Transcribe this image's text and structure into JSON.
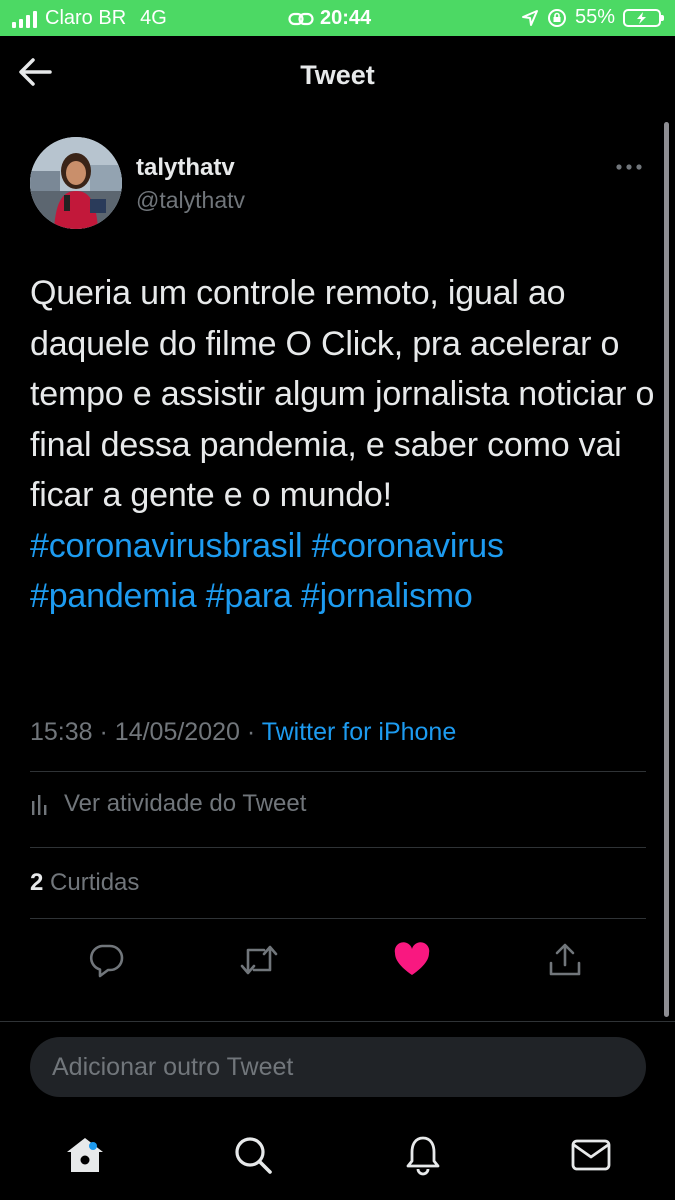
{
  "status_bar": {
    "carrier": "Claro BR",
    "network": "4G",
    "time": "20:44",
    "battery": "55%",
    "background": "#4cd964"
  },
  "header": {
    "title": "Tweet",
    "back_icon": "arrow-left-icon"
  },
  "tweet": {
    "display_name": "talythatv",
    "handle": "@talythatv",
    "text": "Queria um controle remoto, igual ao daquele do filme O Click, pra acelerar o tempo e assistir algum jornalista noticiar o final dessa pandemia, e saber como vai ficar a gente e o mundo!",
    "hashtags": [
      "#coronavirusbrasil",
      "#coronavirus",
      "#pandemia",
      "#para",
      "#jornalismo"
    ],
    "time": "15:38",
    "date": "14/05/2020",
    "separator": "·",
    "source": "Twitter for iPhone",
    "activity_label": "Ver atividade do Tweet",
    "likes_count": "2",
    "likes_label": "Curtidas",
    "liked": true
  },
  "actions": [
    "reply-icon",
    "retweet-icon",
    "heart-icon",
    "share-icon"
  ],
  "compose": {
    "placeholder": "Adicionar outro Tweet"
  },
  "tab_bar": [
    "home-icon",
    "search-icon",
    "bell-icon",
    "mail-icon"
  ],
  "colors": {
    "background": "#000000",
    "text": "#e7e9ea",
    "secondary_text": "#71767b",
    "link": "#1d9bf0",
    "like": "#f91880",
    "divider": "#2f3336"
  }
}
